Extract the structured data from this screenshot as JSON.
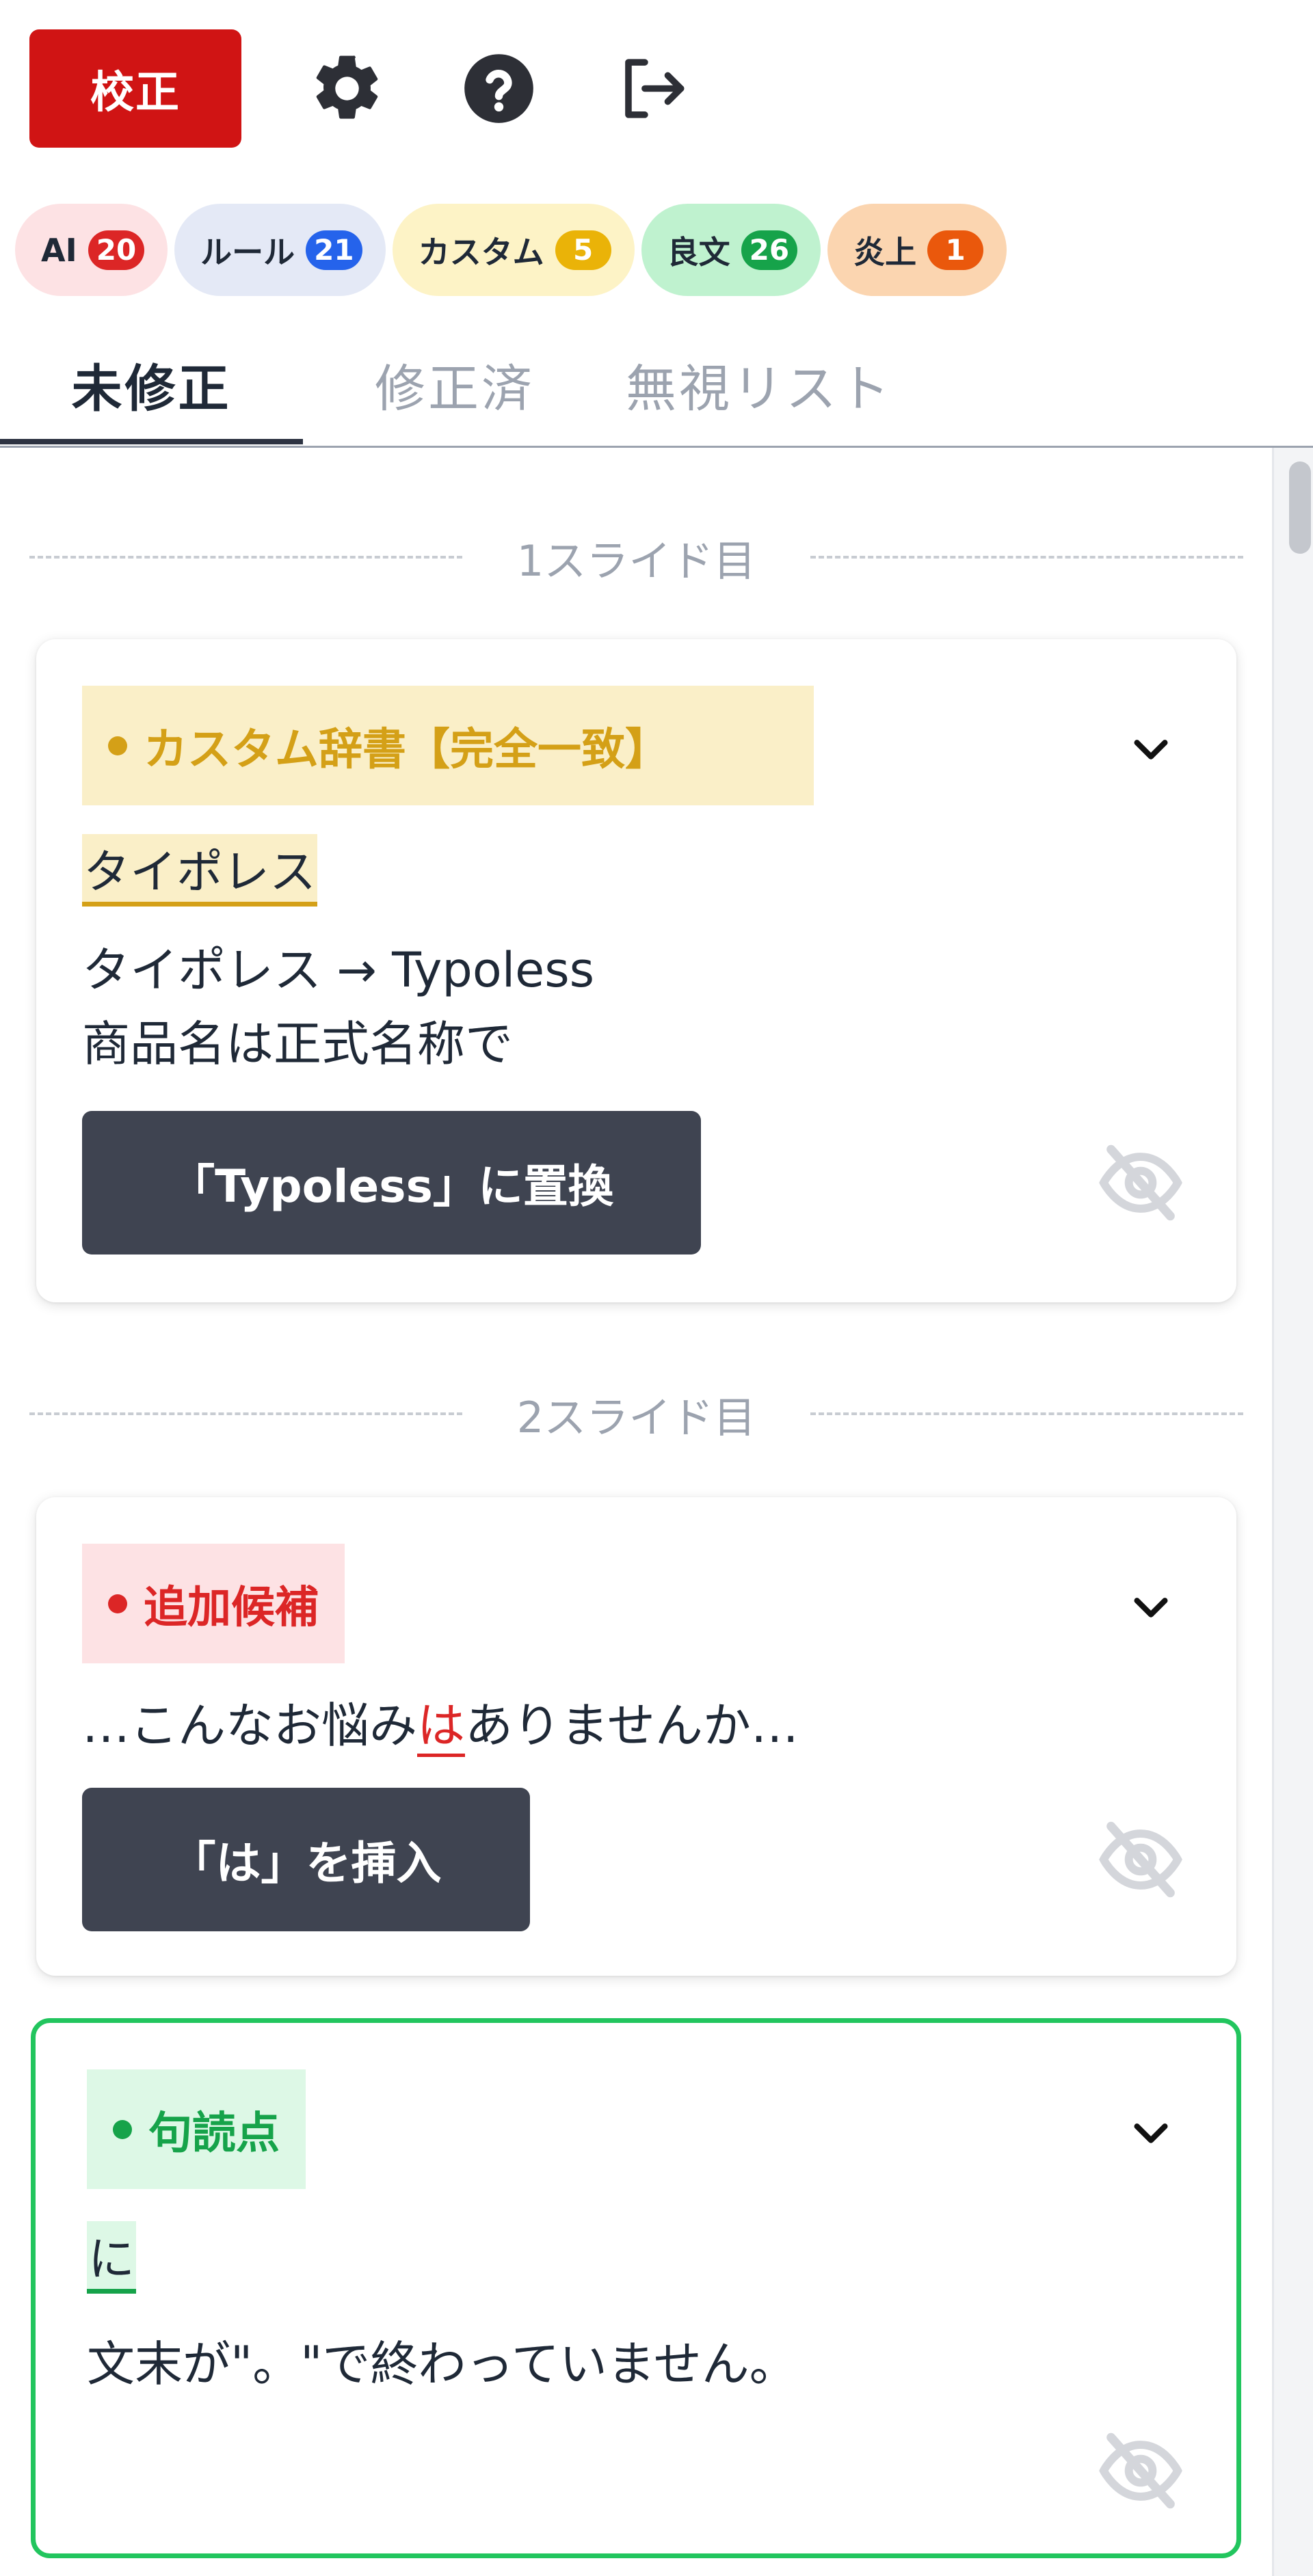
{
  "toolbar": {
    "proofread_label": "校正",
    "icons": [
      "gear-icon",
      "help-icon",
      "logout-icon"
    ]
  },
  "chips": [
    {
      "label": "AI",
      "count": "20",
      "bg": "#fde2e4",
      "badge": "#dc2626"
    },
    {
      "label": "ルール",
      "count": "21",
      "bg": "#e4e9f6",
      "badge": "#2563eb"
    },
    {
      "label": "カスタム",
      "count": "5",
      "bg": "#fdf3c6",
      "badge": "#eab308"
    },
    {
      "label": "良文",
      "count": "26",
      "bg": "#bff2cf",
      "badge": "#16a34a"
    },
    {
      "label": "炎上",
      "count": "1",
      "bg": "#fbd5b0",
      "badge": "#ea580c"
    }
  ],
  "tabs": {
    "unfixed": "未修正",
    "fixed": "修正済",
    "ignored": "無視リスト"
  },
  "sections": [
    {
      "label": "1スライド目"
    },
    {
      "label": "2スライド目"
    }
  ],
  "cards": [
    {
      "tag": "カスタム辞書【完全一致】",
      "tag_color": "#d4a017",
      "tag_bg": "#faefc8",
      "word": "タイポレス",
      "message_line1": "タイポレス → Typoless",
      "message_line2": "商品名は正式名称で",
      "button": "「Typoless」に置換"
    },
    {
      "tag": "追加候補",
      "tag_color": "#dc2626",
      "tag_bg": "#fde2e4",
      "context_before": "…こんなお悩み",
      "context_highlight": "は",
      "context_after": "ありませんか…",
      "button": "「は」を挿入"
    },
    {
      "tag": "句読点",
      "tag_color": "#16a34a",
      "tag_bg": "#ddf8e6",
      "word": "に",
      "message_line1": "文末が\"。\"で終わっていません。"
    }
  ]
}
